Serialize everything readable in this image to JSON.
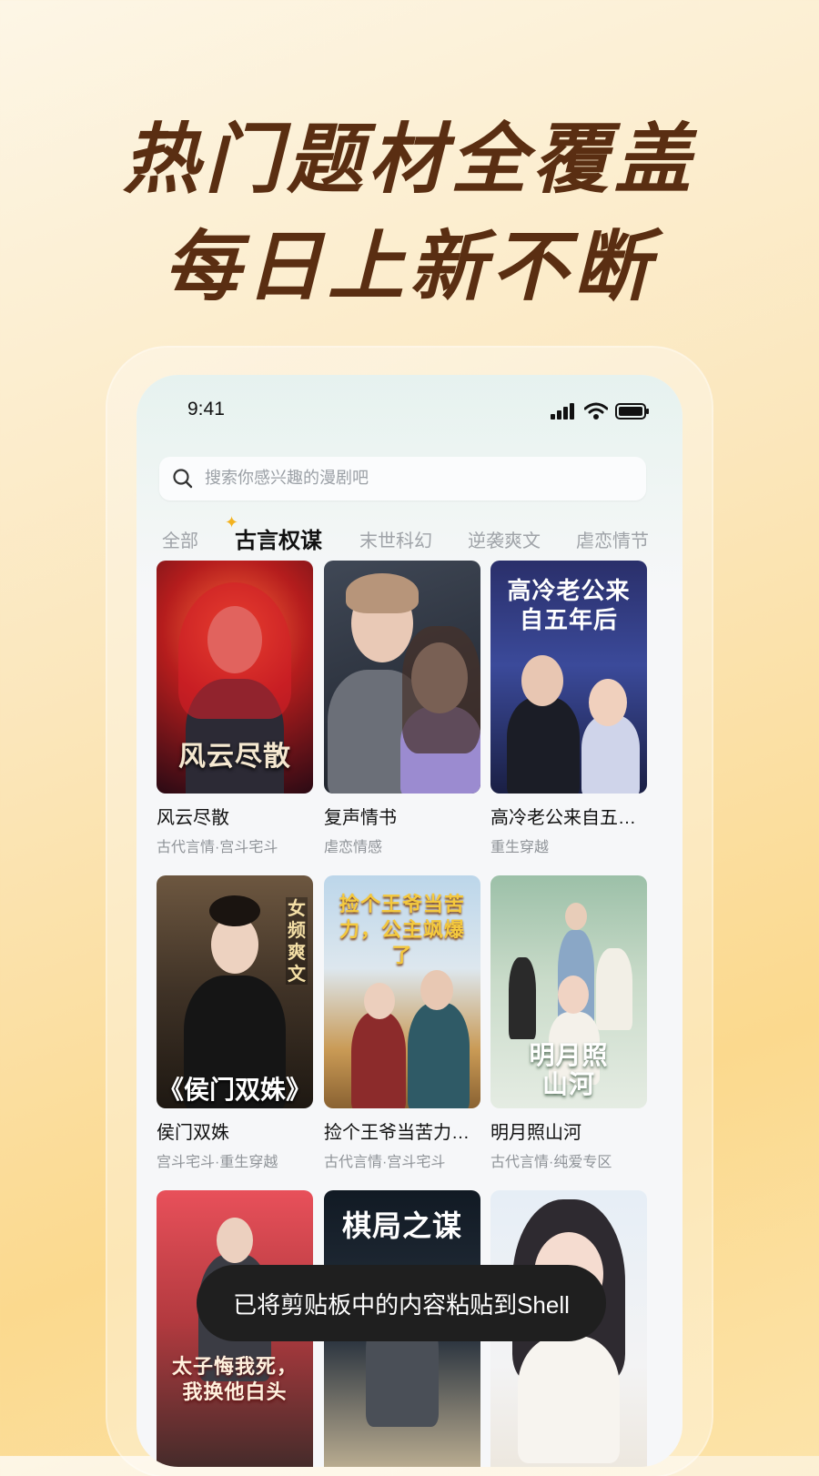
{
  "promo": {
    "headline_1": "热门题材全覆盖",
    "headline_2": "每日上新不断"
  },
  "status_bar": {
    "time": "9:41"
  },
  "search": {
    "placeholder": "搜索你感兴趣的漫剧吧"
  },
  "tabs": [
    {
      "label": "全部",
      "active": false
    },
    {
      "label": "古言权谋",
      "active": true
    },
    {
      "label": "末世科幻",
      "active": false
    },
    {
      "label": "逆袭爽文",
      "active": false
    },
    {
      "label": "虐恋情节",
      "active": false
    }
  ],
  "cards": [
    {
      "title": "风云尽散",
      "tags": "古代言情·宫斗宅斗",
      "cover_text": "风云尽散"
    },
    {
      "title": "复声情书",
      "tags": "虐恋情感",
      "cover_text": ""
    },
    {
      "title": "高冷老公来自五…",
      "tags": "重生穿越",
      "cover_text": "高冷老公来自五年后"
    },
    {
      "title": "侯门双姝",
      "tags": "宫斗宅斗·重生穿越",
      "cover_text": "《侯门双姝》",
      "cover_badge": "女频爽文"
    },
    {
      "title": "捡个王爷当苦力…",
      "tags": "古代言情·宫斗宅斗",
      "cover_text": "捡个王爷当苦力，公主飒爆了"
    },
    {
      "title": "明月照山河",
      "tags": "古代言情·纯爱专区",
      "cover_text": "明月照山河"
    },
    {
      "title": "",
      "tags": "",
      "cover_text": "太子悔我死，我换他白头"
    },
    {
      "title": "",
      "tags": "",
      "cover_text": "棋局之谋"
    },
    {
      "title": "",
      "tags": "",
      "cover_text": ""
    }
  ],
  "toast": {
    "message": "已将剪贴板中的内容粘贴到Shell"
  },
  "colors": {
    "headline": "#5a2e12",
    "accent": "#f3b21f",
    "toast_bg": "#1f1f1f"
  }
}
